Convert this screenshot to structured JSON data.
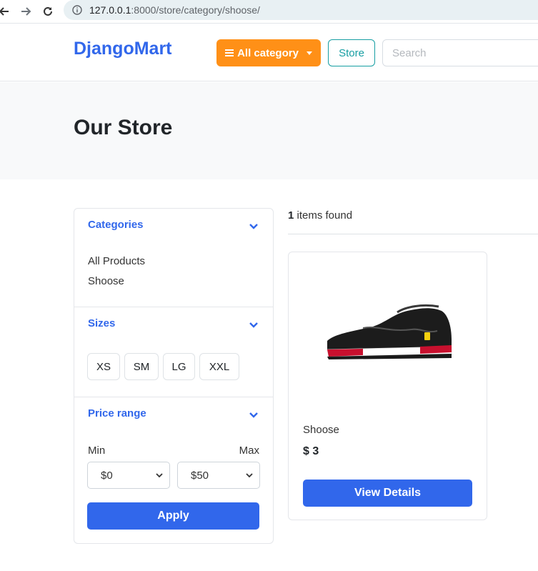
{
  "browser": {
    "url_host": "127.0.0.1",
    "url_path": ":8000/store/category/shoose/",
    "icons": [
      "back-arrow-icon",
      "forward-arrow-icon",
      "reload-icon",
      "info-icon"
    ]
  },
  "header": {
    "brand": "DjangoMart",
    "category_button": "All category",
    "store_button": "Store",
    "search_placeholder": "Search"
  },
  "page": {
    "title": "Our Store"
  },
  "sidebar": {
    "categories": {
      "heading": "Categories",
      "items": [
        "All Products",
        "Shoose"
      ]
    },
    "sizes": {
      "heading": "Sizes",
      "items": [
        "XS",
        "SM",
        "LG",
        "XXL"
      ]
    },
    "price": {
      "heading": "Price range",
      "min_label": "Min",
      "max_label": "Max",
      "min_value": "$0",
      "max_value": "$50",
      "apply_label": "Apply"
    }
  },
  "results": {
    "count": "1",
    "count_suffix": " items found",
    "products": [
      {
        "name": "Shoose",
        "price": "$ 3",
        "button": "View Details"
      }
    ]
  },
  "colors": {
    "primary": "#3167eb",
    "orange": "#ff9017",
    "teal": "#179ea3"
  }
}
